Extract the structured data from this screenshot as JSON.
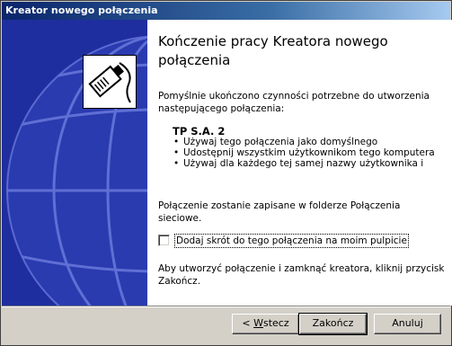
{
  "window": {
    "title": "Kreator nowego połączenia"
  },
  "icons": {
    "network_cable": "network-cable-icon",
    "globe": "globe-icon"
  },
  "colors": {
    "title_bar": "#0a246a",
    "left_panel": "#1f2e9f",
    "content_bg": "#ffffff",
    "dialog_bg": "#d4d0c8"
  },
  "content": {
    "heading": "Kończenie pracy Kreatora nowego połączenia",
    "intro": "Pomyślnie ukończono czynności potrzebne do utworzenia następującego połączenia:",
    "connection_name": "TP S.A. 2",
    "bullets": [
      "Używaj tego połączenia jako domyślnego",
      "Udostępnij wszystkim użytkownikom tego komputera",
      "Używaj dla każdego tej samej nazwy użytkownika i"
    ],
    "save_note": "Połączenie zostanie zapisane w folderze Połączenia sieciowe.",
    "shortcut_checkbox": {
      "label": "Dodaj skrót do tego połączenia na moim pulpicie",
      "checked": false
    },
    "finish_note": "Aby utworzyć połączenie i zamknąć kreatora, kliknij przycisk Zakończ."
  },
  "buttons": {
    "back_prefix": "< ",
    "back_underlined": "W",
    "back_rest": "stecz",
    "finish": "Zakończ",
    "cancel": "Anuluj"
  }
}
